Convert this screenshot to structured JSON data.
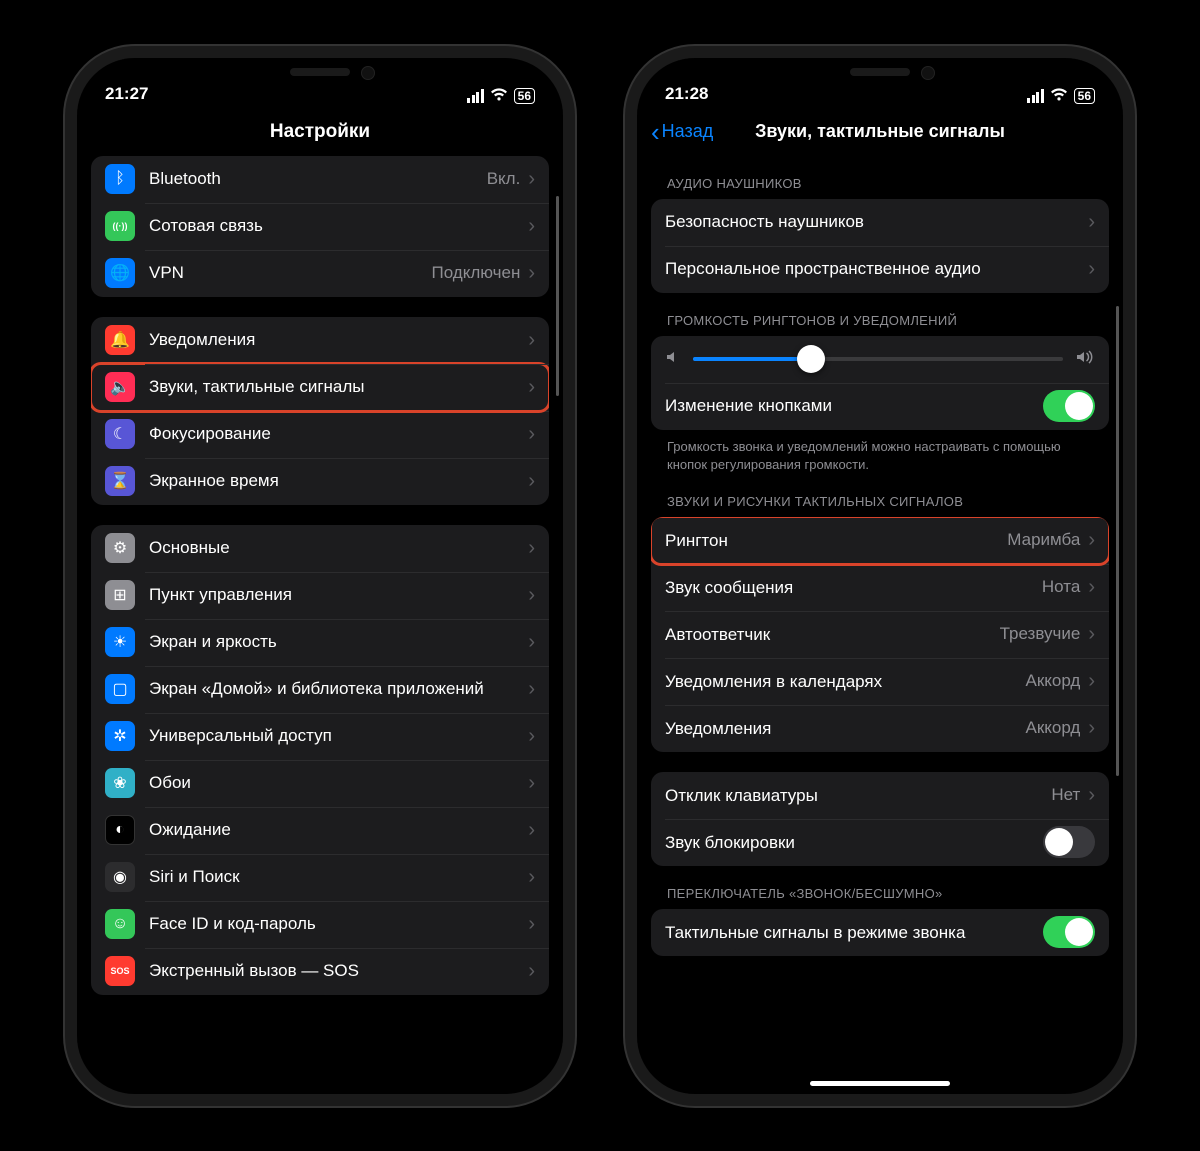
{
  "left": {
    "time": "21:27",
    "battery": "56",
    "title": "Настройки",
    "group1": [
      {
        "icon": "bluetooth-icon",
        "bg": "bg-blue",
        "glyph": "ᛒ",
        "label": "Bluetooth",
        "value": "Вкл."
      },
      {
        "icon": "cellular-icon",
        "bg": "bg-green",
        "glyph": "((·))",
        "label": "Сотовая связь",
        "value": ""
      },
      {
        "icon": "vpn-icon",
        "bg": "bg-blue",
        "glyph": "🌐",
        "label": "VPN",
        "value": "Подключен"
      }
    ],
    "group2": [
      {
        "icon": "notifications-icon",
        "bg": "bg-red",
        "glyph": "🔔",
        "label": "Уведомления",
        "value": "",
        "hl": false
      },
      {
        "icon": "sounds-icon",
        "bg": "bg-crimson",
        "glyph": "🔈",
        "label": "Звуки, тактильные сигналы",
        "value": "",
        "hl": true
      },
      {
        "icon": "focus-icon",
        "bg": "bg-indigo",
        "glyph": "☾",
        "label": "Фокусирование",
        "value": "",
        "hl": false
      },
      {
        "icon": "screentime-icon",
        "bg": "bg-indigo",
        "glyph": "⌛",
        "label": "Экранное время",
        "value": "",
        "hl": false
      }
    ],
    "group3": [
      {
        "icon": "general-icon",
        "bg": "bg-gray",
        "glyph": "⚙",
        "label": "Основные",
        "value": ""
      },
      {
        "icon": "control-center-icon",
        "bg": "bg-gray",
        "glyph": "⊞",
        "label": "Пункт управления",
        "value": ""
      },
      {
        "icon": "display-icon",
        "bg": "bg-blue",
        "glyph": "☀",
        "label": "Экран и яркость",
        "value": ""
      },
      {
        "icon": "home-screen-icon",
        "bg": "bg-blue",
        "glyph": "▢",
        "label": "Экран «Домой» и библиотека приложений",
        "value": ""
      },
      {
        "icon": "accessibility-icon",
        "bg": "bg-blue",
        "glyph": "✲",
        "label": "Универсальный доступ",
        "value": ""
      },
      {
        "icon": "wallpaper-icon",
        "bg": "bg-teal",
        "glyph": "❀",
        "label": "Обои",
        "value": ""
      },
      {
        "icon": "standby-icon",
        "bg": "bg-black",
        "glyph": "◐",
        "label": "Ожидание",
        "value": ""
      },
      {
        "icon": "siri-icon",
        "bg": "bg-dark",
        "glyph": "◉",
        "label": "Siri и Поиск",
        "value": ""
      },
      {
        "icon": "faceid-icon",
        "bg": "bg-green",
        "glyph": "☺",
        "label": "Face ID и код-пароль",
        "value": ""
      },
      {
        "icon": "sos-icon",
        "bg": "bg-red",
        "glyph": "SOS",
        "label": "Экстренный вызов — SOS",
        "value": ""
      }
    ]
  },
  "right": {
    "time": "21:28",
    "battery": "56",
    "back": "Назад",
    "title": "Звуки, тактильные сигналы",
    "headphones_header": "АУДИО НАУШНИКОВ",
    "headphones": [
      {
        "label": "Безопасность наушников"
      },
      {
        "label": "Персональное пространственное аудио"
      }
    ],
    "volume_header": "ГРОМКОСТЬ РИНГТОНОВ И УВЕДОМЛЕНИЙ",
    "slider_percent": 32,
    "change_buttons_label": "Изменение кнопками",
    "change_buttons_on": true,
    "volume_footer": "Громкость звонка и уведомлений можно настраивать с помощью кнопок регулирования громкости.",
    "sounds_header": "ЗВУКИ И РИСУНКИ ТАКТИЛЬНЫХ СИГНАЛОВ",
    "sounds": [
      {
        "label": "Рингтон",
        "value": "Маримба",
        "hl": true
      },
      {
        "label": "Звук сообщения",
        "value": "Нота",
        "hl": false
      },
      {
        "label": "Автоответчик",
        "value": "Трезвучие",
        "hl": false
      },
      {
        "label": "Уведомления в календарях",
        "value": "Аккорд",
        "hl": false
      },
      {
        "label": "Уведомления",
        "value": "Аккорд",
        "hl": false
      }
    ],
    "keyboard": [
      {
        "label": "Отклик клавиатуры",
        "value": "Нет",
        "type": "chevron"
      },
      {
        "label": "Звук блокировки",
        "value": "",
        "type": "switch",
        "on": false
      }
    ],
    "silent_header": "ПЕРЕКЛЮЧАТЕЛЬ «ЗВОНОК/БЕСШУМНО»",
    "silent_label": "Тактильные сигналы в режиме звонка",
    "silent_on": true
  }
}
